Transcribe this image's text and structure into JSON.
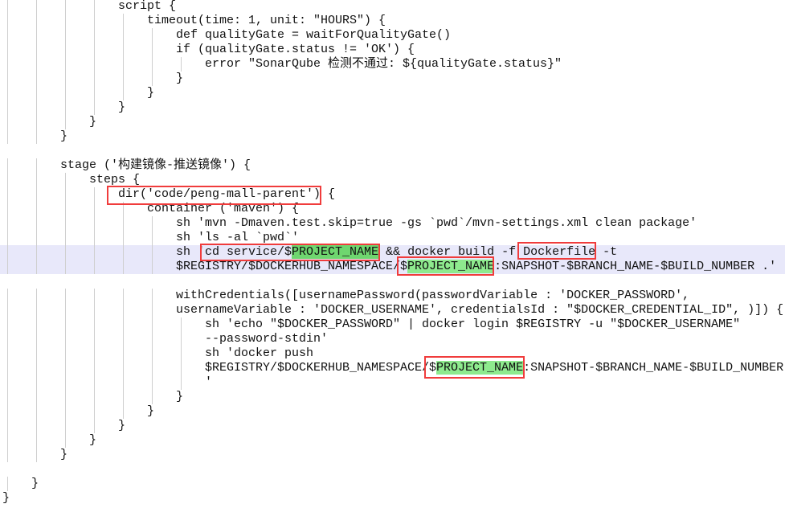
{
  "editor": {
    "colors": {
      "current_line": "#e8e8fa",
      "match_highlight": "#8eea8e",
      "selected_match": "#6fd66f",
      "annotation_box": "#f03c3c"
    },
    "lines": [
      {
        "indent": 4,
        "segs": [
          {
            "t": "script {"
          }
        ]
      },
      {
        "indent": 5,
        "segs": [
          {
            "t": "timeout(time: 1, unit: \"HOURS\") {"
          }
        ]
      },
      {
        "indent": 6,
        "segs": [
          {
            "t": "def qualityGate = waitForQualityGate()"
          }
        ]
      },
      {
        "indent": 6,
        "segs": [
          {
            "t": "if (qualityGate.status != 'OK') {"
          }
        ]
      },
      {
        "indent": 7,
        "segs": [
          {
            "t": "error \"SonarQube 检测不通过: ${qualityGate.status}\""
          }
        ]
      },
      {
        "indent": 6,
        "segs": [
          {
            "t": "}"
          }
        ]
      },
      {
        "indent": 5,
        "segs": [
          {
            "t": "}"
          }
        ]
      },
      {
        "indent": 4,
        "segs": [
          {
            "t": "}"
          }
        ]
      },
      {
        "indent": 3,
        "segs": [
          {
            "t": "}"
          }
        ]
      },
      {
        "indent": 2,
        "segs": [
          {
            "t": "}"
          }
        ]
      },
      {
        "indent": 0,
        "segs": []
      },
      {
        "indent": 2,
        "segs": [
          {
            "t": "stage ('构建镜像-推送镜像') {"
          }
        ]
      },
      {
        "indent": 3,
        "segs": [
          {
            "t": "steps {"
          }
        ]
      },
      {
        "indent": 4,
        "segs": [
          {
            "t": "dir('code/peng-mall-parent') {"
          }
        ]
      },
      {
        "indent": 5,
        "segs": [
          {
            "t": "container ('maven') {"
          }
        ]
      },
      {
        "indent": 6,
        "segs": [
          {
            "t": "sh 'mvn -Dmaven.test.skip=true -gs `pwd`/mvn-settings.xml clean package'"
          }
        ]
      },
      {
        "indent": 6,
        "segs": [
          {
            "t": "sh 'ls -al `pwd`'"
          }
        ]
      },
      {
        "indent": 6,
        "current": true,
        "segs": [
          {
            "t": "sh 'cd service/$"
          },
          {
            "t": "PROJECT_NAME",
            "hl": "ms"
          },
          {
            "t": " && docker build -f Dockerfile -t"
          }
        ]
      },
      {
        "indent": 6,
        "current": true,
        "segs": [
          {
            "t": "$REGISTRY/$DOCKERHUB_NAMESPACE/$"
          },
          {
            "t": "PROJECT_NAME",
            "hl": "m"
          },
          {
            "t": ":SNAPSHOT-$BRANCH_NAME-$BUILD_NUMBER .'"
          }
        ]
      },
      {
        "indent": 0,
        "segs": []
      },
      {
        "indent": 6,
        "segs": [
          {
            "t": "withCredentials([usernamePassword(passwordVariable : 'DOCKER_PASSWORD',"
          }
        ]
      },
      {
        "indent": 6,
        "segs": [
          {
            "t": "usernameVariable : 'DOCKER_USERNAME', credentialsId : \"$DOCKER_CREDENTIAL_ID\", )]) {"
          }
        ]
      },
      {
        "indent": 7,
        "segs": [
          {
            "t": "sh 'echo \"$DOCKER_PASSWORD\" | docker login $REGISTRY -u \"$DOCKER_USERNAME\""
          }
        ]
      },
      {
        "indent": 7,
        "segs": [
          {
            "t": "--password-stdin'"
          }
        ]
      },
      {
        "indent": 7,
        "segs": [
          {
            "t": "sh 'docker push"
          }
        ]
      },
      {
        "indent": 7,
        "segs": [
          {
            "t": "$REGISTRY/$DOCKERHUB_NAMESPACE/$"
          },
          {
            "t": "PROJECT_NAME",
            "hl": "m"
          },
          {
            "t": ":SNAPSHOT-$BRANCH_NAME-$BUILD_NUMBER"
          }
        ]
      },
      {
        "indent": 7,
        "segs": [
          {
            "t": "'"
          }
        ]
      },
      {
        "indent": 6,
        "segs": [
          {
            "t": "}"
          }
        ]
      },
      {
        "indent": 5,
        "segs": [
          {
            "t": "}"
          }
        ]
      },
      {
        "indent": 4,
        "segs": [
          {
            "t": "}"
          }
        ]
      },
      {
        "indent": 3,
        "segs": [
          {
            "t": "}"
          }
        ]
      },
      {
        "indent": 2,
        "segs": [
          {
            "t": "}"
          }
        ]
      },
      {
        "indent": 0,
        "segs": []
      },
      {
        "indent": 1,
        "segs": [
          {
            "t": "}"
          }
        ]
      },
      {
        "indent": 0,
        "segs": [
          {
            "t": "}"
          }
        ]
      }
    ]
  }
}
